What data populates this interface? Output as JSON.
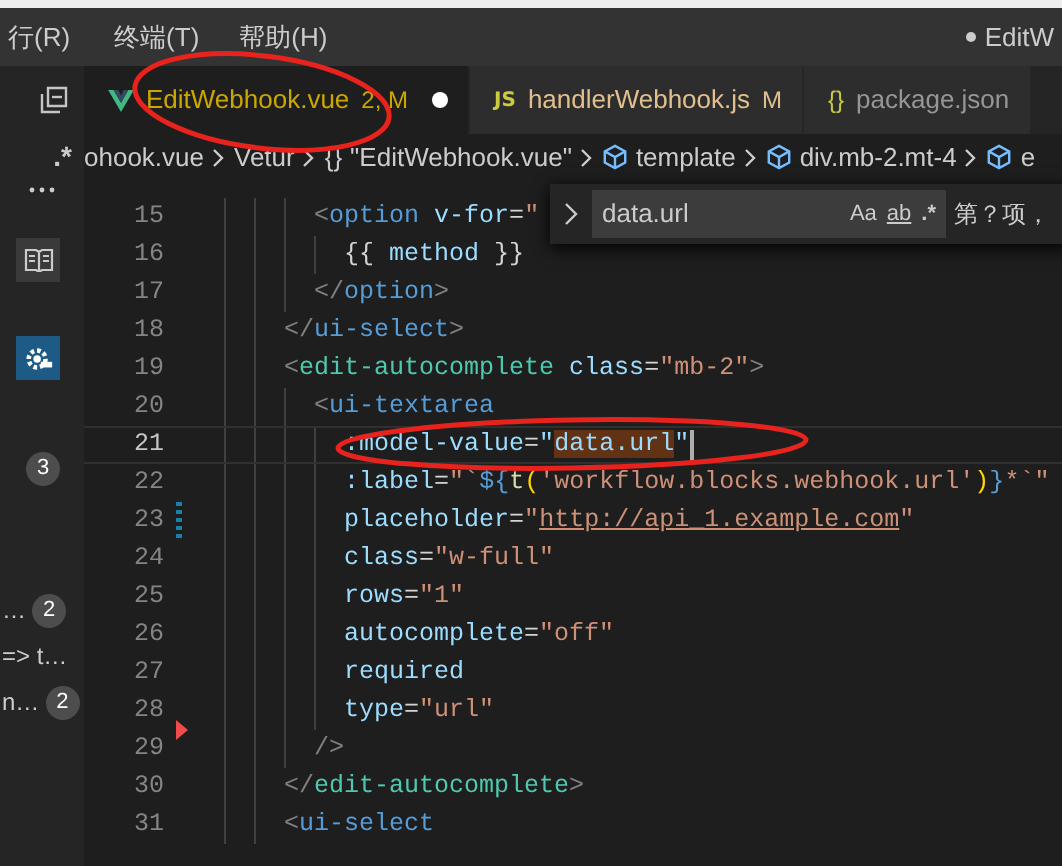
{
  "menu": {
    "items": [
      "行(R)",
      "终端(T)",
      "帮助(H)"
    ],
    "window_title": "EditW",
    "unsaved": true
  },
  "tabs": [
    {
      "kind": "vue",
      "label": "EditWebhook.vue",
      "status": "2, M",
      "selected": true,
      "dirty": true
    },
    {
      "kind": "js",
      "icon_text": "JS",
      "label": "handlerWebhook.js",
      "status": "M",
      "selected": false,
      "dirty": false
    },
    {
      "kind": "json",
      "icon_text": "{}",
      "label": "package.json",
      "selected": false,
      "dirty": false
    }
  ],
  "sidebar": {
    "regex_toggle": ".*",
    "badge": "3",
    "results": [
      {
        "text": "…",
        "badge": "2"
      },
      {
        "text": "=> t…"
      },
      {
        "text": "n…",
        "badge": "2"
      }
    ]
  },
  "breadcrumb": [
    {
      "label": "ohook.vue"
    },
    {
      "label": "Vetur"
    },
    {
      "glyph": "{}",
      "label": "\"EditWebhook.vue\""
    },
    {
      "kind": "element",
      "label": "template"
    },
    {
      "kind": "element",
      "label": "div.mb-2.mt-4"
    },
    {
      "kind": "element",
      "label": "e"
    }
  ],
  "find": {
    "value": "data.url",
    "options": [
      "Aa",
      "ab",
      ".*"
    ],
    "result": "第？项，"
  },
  "editor": {
    "lines": [
      {
        "number": "15",
        "tokens": [
          {
            "kind": "p",
            "text": "      <"
          },
          {
            "kind": "tag",
            "text": "option"
          },
          {
            "kind": "attr",
            "text": " v-for"
          },
          {
            "kind": "t",
            "text": "="
          },
          {
            "kind": "str",
            "text": "\""
          }
        ]
      },
      {
        "number": "16",
        "tokens": [
          {
            "kind": "t",
            "text": "        {{ "
          },
          {
            "kind": "attr",
            "text": "method"
          },
          {
            "kind": "t",
            "text": " }}"
          }
        ]
      },
      {
        "number": "17",
        "tokens": [
          {
            "kind": "p",
            "text": "      </"
          },
          {
            "kind": "tag",
            "text": "option"
          },
          {
            "kind": "p",
            "text": ">"
          }
        ]
      },
      {
        "number": "18",
        "tokens": [
          {
            "kind": "p",
            "text": "    </"
          },
          {
            "kind": "tag",
            "text": "ui-select"
          },
          {
            "kind": "p",
            "text": ">"
          }
        ]
      },
      {
        "number": "19",
        "tokens": [
          {
            "kind": "p",
            "text": "    <"
          },
          {
            "kind": "comp",
            "text": "edit-autocomplete"
          },
          {
            "kind": "attr",
            "text": " class"
          },
          {
            "kind": "t",
            "text": "="
          },
          {
            "kind": "str",
            "text": "\"mb-2\""
          },
          {
            "kind": "p",
            "text": ">"
          }
        ]
      },
      {
        "number": "20",
        "tokens": [
          {
            "kind": "p",
            "text": "      <"
          },
          {
            "kind": "tag",
            "text": "ui-textarea"
          }
        ]
      },
      {
        "number": "21",
        "current": true,
        "tokens": [
          {
            "kind": "attr",
            "text": "        :model-value"
          },
          {
            "kind": "t",
            "text": "="
          },
          {
            "kind": "attr",
            "text": "\""
          },
          {
            "kind": "match",
            "text": "data.url"
          },
          {
            "kind": "attr",
            "text": "\""
          }
        ]
      },
      {
        "number": "22",
        "tokens": [
          {
            "kind": "attr",
            "text": "        :label"
          },
          {
            "kind": "t",
            "text": "="
          },
          {
            "kind": "str",
            "text": "\"`"
          },
          {
            "kind": "kw",
            "text": "${"
          },
          {
            "kind": "fn",
            "text": "t"
          },
          {
            "kind": "br",
            "text": "("
          },
          {
            "kind": "str",
            "text": "'workflow.blocks.webhook.url'"
          },
          {
            "kind": "br",
            "text": ")"
          },
          {
            "kind": "kw",
            "text": "}"
          },
          {
            "kind": "str",
            "text": "*`\""
          }
        ]
      },
      {
        "number": "23",
        "modified": true,
        "tokens": [
          {
            "kind": "attr",
            "text": "        placeholder"
          },
          {
            "kind": "t",
            "text": "="
          },
          {
            "kind": "str",
            "text": "\""
          },
          {
            "kind": "link",
            "text": "http://api_1.example.com"
          },
          {
            "kind": "str",
            "text": "\""
          }
        ]
      },
      {
        "number": "24",
        "tokens": [
          {
            "kind": "attr",
            "text": "        class"
          },
          {
            "kind": "t",
            "text": "="
          },
          {
            "kind": "str",
            "text": "\"w-full\""
          }
        ]
      },
      {
        "number": "25",
        "tokens": [
          {
            "kind": "attr",
            "text": "        rows"
          },
          {
            "kind": "t",
            "text": "="
          },
          {
            "kind": "str",
            "text": "\"1\""
          }
        ]
      },
      {
        "number": "26",
        "tokens": [
          {
            "kind": "attr",
            "text": "        autocomplete"
          },
          {
            "kind": "t",
            "text": "="
          },
          {
            "kind": "str",
            "text": "\"off\""
          }
        ]
      },
      {
        "number": "27",
        "tokens": [
          {
            "kind": "attr",
            "text": "        required"
          }
        ]
      },
      {
        "number": "28",
        "deleted": true,
        "tokens": [
          {
            "kind": "attr",
            "text": "        type"
          },
          {
            "kind": "t",
            "text": "="
          },
          {
            "kind": "str",
            "text": "\"url\""
          }
        ]
      },
      {
        "number": "29",
        "tokens": [
          {
            "kind": "p",
            "text": "      />"
          }
        ]
      },
      {
        "number": "30",
        "tokens": [
          {
            "kind": "p",
            "text": "    </"
          },
          {
            "kind": "comp",
            "text": "edit-autocomplete"
          },
          {
            "kind": "p",
            "text": ">"
          }
        ]
      },
      {
        "number": "31",
        "tokens": [
          {
            "kind": "p",
            "text": "    <"
          },
          {
            "kind": "tag",
            "text": "ui-select"
          }
        ]
      }
    ]
  }
}
